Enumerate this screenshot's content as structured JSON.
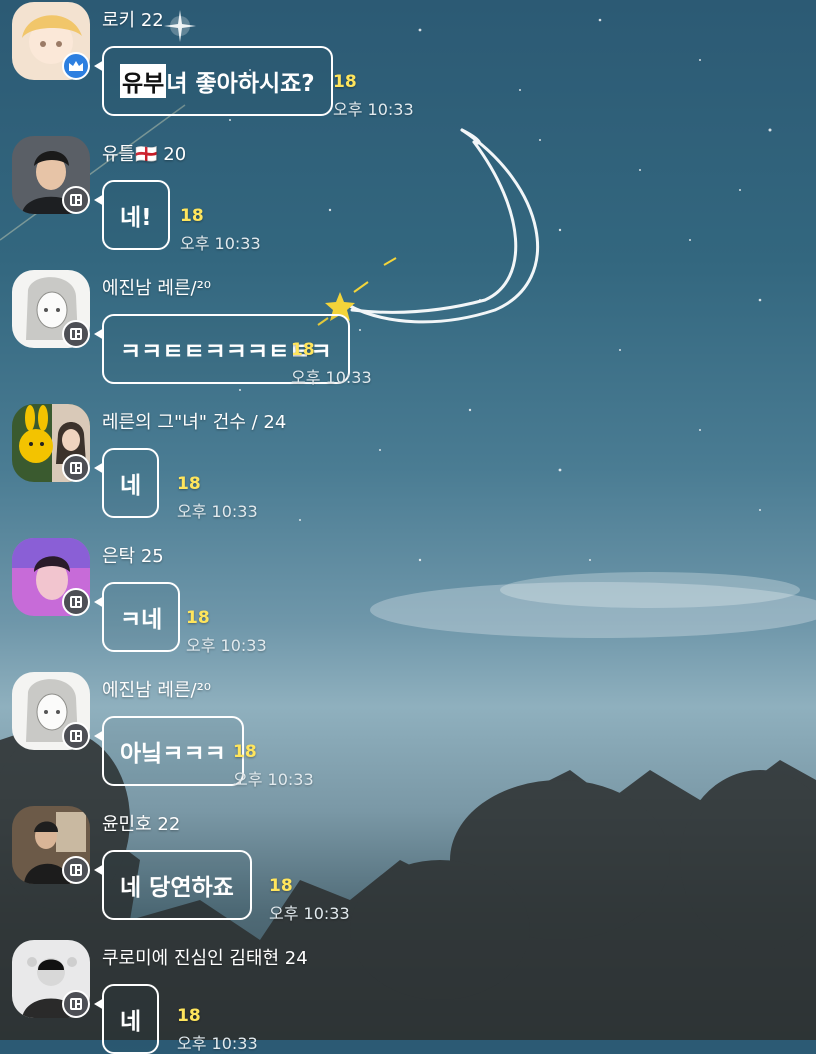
{
  "colors": {
    "bubble_border": "#ffffff",
    "unread_count": "#ffe55c",
    "timestamp": "#e2eaee",
    "crown_badge": "#2d7fe0",
    "profile_badge": "#4d4f55"
  },
  "messages": [
    {
      "sender": "로키 22",
      "text_highlight": "유부",
      "text": "녀 좋아하시죠?",
      "unread": "18",
      "time": "오후 10:33",
      "badge_icon": "crown-icon"
    },
    {
      "sender": "유틀🏴󠁧󠁢󠁥󠁮󠁧󠁿 20",
      "text_highlight": "",
      "text": "네!",
      "unread": "18",
      "time": "오후 10:33",
      "badge_icon": "profile-card-icon"
    },
    {
      "sender": "에진남 레른/²⁰",
      "text_highlight": "",
      "text": "ㅋㅋㅌㅌㅋㅋㅋㅌㅌㅋ",
      "unread": "18",
      "time": "오후 10:33",
      "badge_icon": "profile-card-icon"
    },
    {
      "sender": "레른의 그\"녀\" 건수 / 24",
      "text_highlight": "",
      "text": "네",
      "unread": "18",
      "time": "오후 10:33",
      "badge_icon": "profile-card-icon"
    },
    {
      "sender": "은탁 25",
      "text_highlight": "",
      "text": "ㅋ네",
      "unread": "18",
      "time": "오후 10:33",
      "badge_icon": "profile-card-icon"
    },
    {
      "sender": "에진남 레른/²⁰",
      "text_highlight": "",
      "text": "아닠ㅋㅋㅋ",
      "unread": "18",
      "time": "오후 10:33",
      "badge_icon": "profile-card-icon"
    },
    {
      "sender": "윤민호 22",
      "text_highlight": "",
      "text": "네 당연하죠",
      "unread": "18",
      "time": "오후 10:33",
      "badge_icon": "profile-card-icon"
    },
    {
      "sender": "쿠로미에 진심인 김태현 24",
      "text_highlight": "",
      "text": "네",
      "unread": "18",
      "time": "오후 10:33",
      "badge_icon": "profile-card-icon"
    }
  ]
}
